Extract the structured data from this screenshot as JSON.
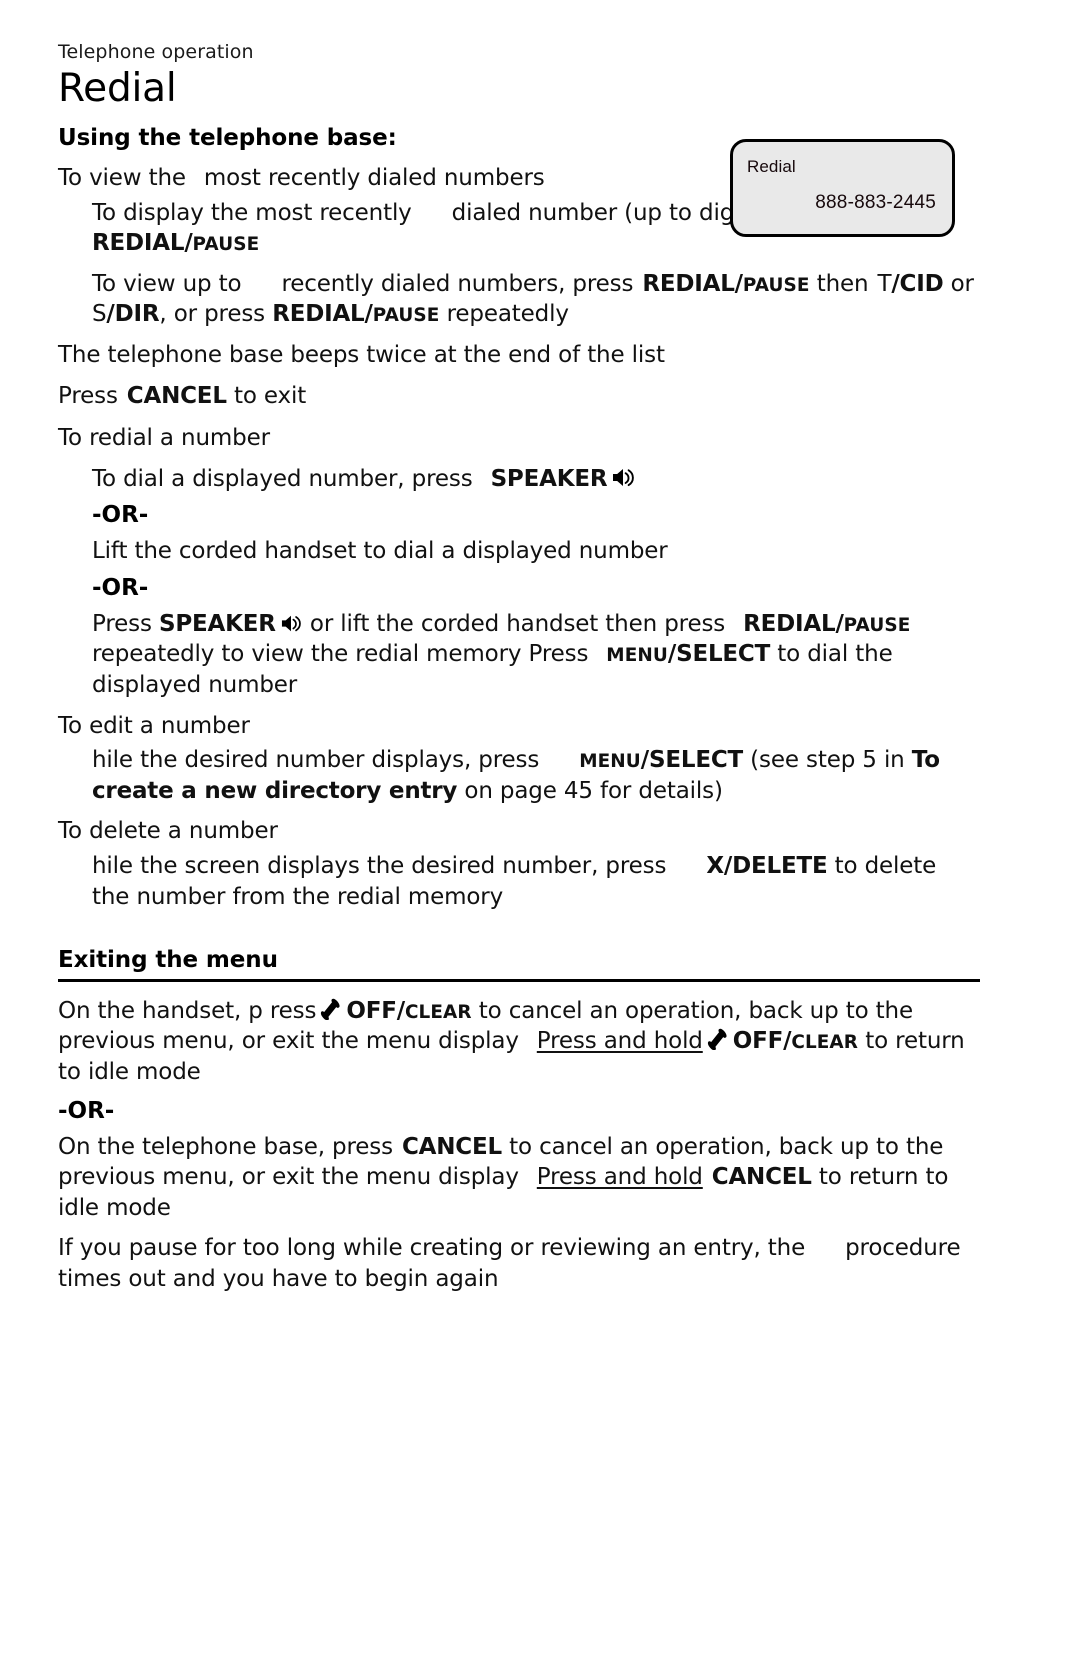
{
  "page": {
    "running_head": "Telephone operation",
    "chapter_title": "Redial"
  },
  "lcd": {
    "label": "Redial",
    "number": "888-883-2445",
    "fill_color": "#e9e9e9",
    "border_color": "#000000"
  },
  "section_base": {
    "heading": "Using the telephone base:",
    "view_intro": {
      "pre": "To view the",
      "post": "most recently dialed numbers"
    },
    "display_recent": {
      "t1": "To display the most recently",
      "t2": "dialed number (up to",
      "t3": "digits), press",
      "key_main": "REDIAL/",
      "key_sub": "PAUSE"
    },
    "view_up_to": {
      "t1": "To view up to",
      "t2": "recently  dialed numbers, press",
      "key1_main": "REDIAL/",
      "key1_sub": "PAUSE",
      "t3": "then",
      "key2_thin": "T",
      "key2_bold": "/CID",
      "t4": "or",
      "key3_thin": "S",
      "key3_bold": "/DIR",
      "t5": ", or  press",
      "key4_main": "REDIAL/",
      "key4_sub": "PAUSE",
      "t6": "repeatedly"
    },
    "beeps": "The  telephone base  beeps twice at the end of the list",
    "exit_line": {
      "pre": "Press",
      "key": "CANCEL",
      "post": "to exit"
    }
  },
  "section_redial": {
    "heading": "To redial a number",
    "dial_displayed": {
      "pre": "To dial  a displayed number, press",
      "key": "SPEAKER",
      "icon": "speaker-icon"
    },
    "or_label": "-OR-",
    "lift_handset": "Lift the corded handset to dial a displayed number",
    "or_label_2": "-OR-",
    "press_speaker": {
      "t1": "Press",
      "key1": "SPEAKER",
      "icon": "speaker-icon",
      "t2": "or lift the corded handset then press",
      "key2_main": "REDIAL/",
      "key2_sub": "PAUSE",
      "t3": "repeatedly to view the redial memory Press",
      "key3_sub": "MENU",
      "key3_main": "/SELECT",
      "t4": "to dial the displayed number"
    }
  },
  "section_edit": {
    "heading": "To edit a number",
    "body": {
      "t1": "hile the desired number displays, press",
      "key_sub": "MENU",
      "key_main": "/SELECT",
      "t2": "(see step 5 in",
      "bold_ref": "To create a new directory entry",
      "t3": "on page 45 for details)"
    }
  },
  "section_delete": {
    "heading": "To delete a number",
    "body": {
      "t1": "hile the screen displays the desired number, press",
      "key": "X/DELETE",
      "t2": "to delete the number from the redial memory"
    }
  },
  "section_exiting": {
    "heading": "Exiting the menu",
    "handset_para": {
      "t1": "On the handset, p  ress",
      "icon": "handset-icon",
      "key1_main": "OFF/",
      "key1_sub": "CLEAR",
      "t2": "to cancel an operation, back up to the previous menu, or exit the menu display",
      "underlined": "Press and hold",
      "icon2": "handset-icon",
      "key2_main": "OFF/",
      "key2_sub": "CLEAR",
      "t3": "to return to idle mode"
    },
    "or_label": "-OR-",
    "base_para": {
      "t1": "On the telephone base, press",
      "key1": "CANCEL",
      "t2": "to cancel an operation, back up to the previous menu, or exit the menu display",
      "underlined": "Press and hold",
      "key2": "CANCEL",
      "t3": "to return to idle mode"
    },
    "timeout_para": {
      "t1": "If you pause for too long while creating or reviewing an entry, the",
      "t2": "procedure times out and you have to begin again"
    }
  }
}
